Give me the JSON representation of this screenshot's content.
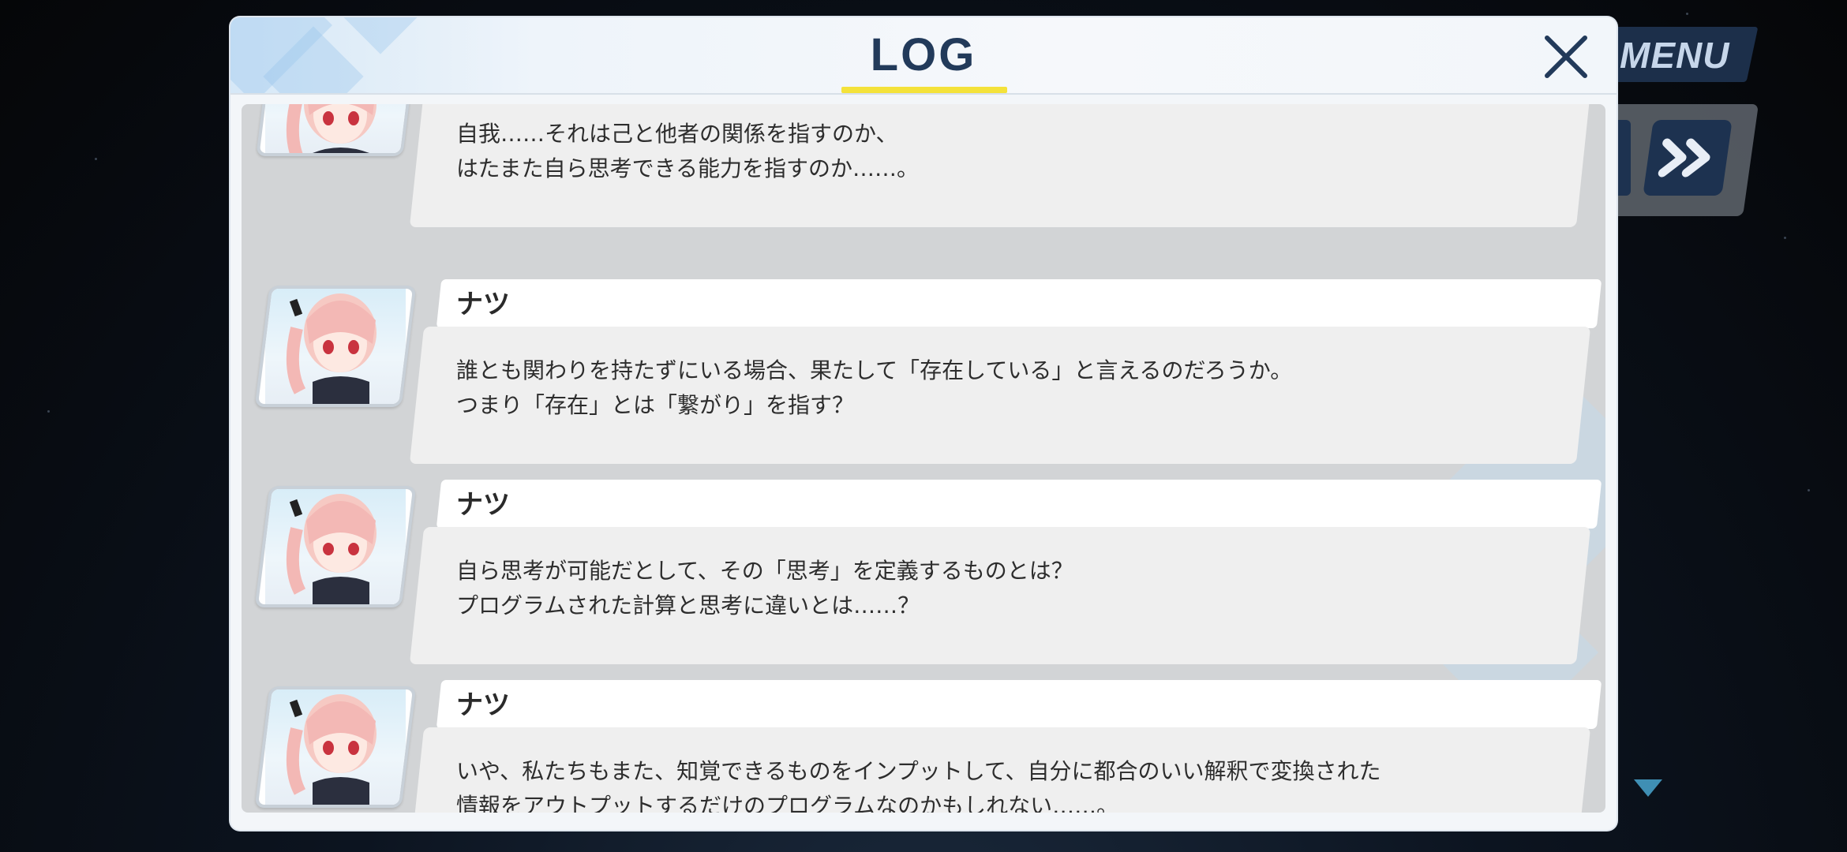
{
  "hud": {
    "menu_label": "MENU",
    "skip_icon": "fast-forward-icon",
    "scroll_icon": "scroll-down-triangle-icon"
  },
  "log": {
    "title": "LOG",
    "close_icon": "close-x-icon",
    "accent_color": "#f4e23a",
    "title_color": "#223a5a",
    "entries": [
      {
        "speaker": "",
        "lines": [
          "自我……それは己と他者の関係を指すのか、",
          "はたまた自ら思考できる能力を指すのか……。"
        ]
      },
      {
        "speaker": "ナツ",
        "lines": [
          "誰とも関わりを持たずにいる場合、果たして「存在している」と言えるのだろうか。",
          "つまり「存在」とは「繋がり」を指す？"
        ]
      },
      {
        "speaker": "ナツ",
        "lines": [
          "自ら思考が可能だとして、その「思考」を定義するものとは？",
          "プログラムされた計算と思考に違いとは……？"
        ]
      },
      {
        "speaker": "ナツ",
        "lines": [
          "いや、私たちもまた、知覚できるものをインプットして、自分に都合のいい解釈で変換された",
          "情報をアウトプットするだけのプログラムなのかもしれない……。"
        ]
      }
    ]
  }
}
